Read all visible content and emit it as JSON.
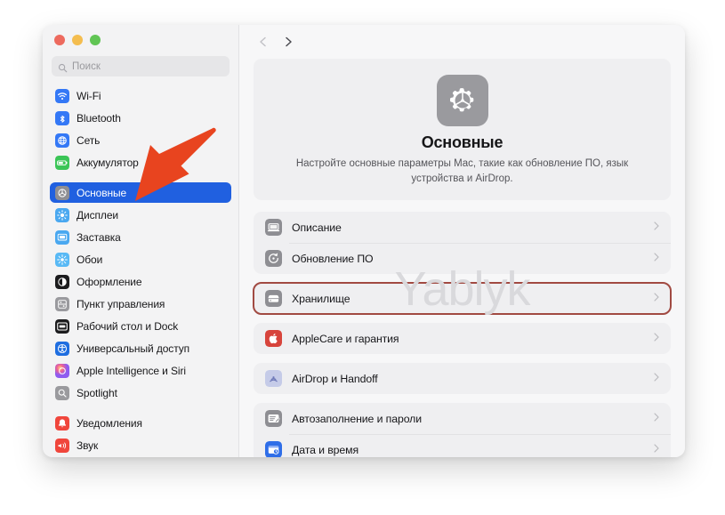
{
  "window": {
    "traffic_lights": [
      {
        "name": "close",
        "color": "#ed6a5e"
      },
      {
        "name": "minimize",
        "color": "#f4bd4f"
      },
      {
        "name": "maximize",
        "color": "#61c554"
      }
    ]
  },
  "search": {
    "placeholder": "Поиск",
    "value": "",
    "icon": "search-icon"
  },
  "sidebar": {
    "groups": [
      {
        "items": [
          {
            "label": "Wi-Fi",
            "icon": "wifi-icon",
            "color": "#3478f6",
            "selected": false
          },
          {
            "label": "Bluetooth",
            "icon": "bluetooth-icon",
            "color": "#3478f6",
            "selected": false
          },
          {
            "label": "Сеть",
            "icon": "globe-icon",
            "color": "#3478f6",
            "selected": false
          },
          {
            "label": "Аккумулятор",
            "icon": "battery-icon",
            "color": "#3bc557",
            "selected": false
          }
        ]
      },
      {
        "items": [
          {
            "label": "Основные",
            "icon": "gear-icon",
            "color": "#8e8e93",
            "selected": true
          },
          {
            "label": "Дисплеи",
            "icon": "display-icon",
            "color": "#4aa8f0",
            "selected": false
          },
          {
            "label": "Заставка",
            "icon": "screensaver-icon",
            "color": "#4aa8f0",
            "selected": false
          },
          {
            "label": "Обои",
            "icon": "wallpaper-icon",
            "color": "#59b9f5",
            "selected": false
          },
          {
            "label": "Оформление",
            "icon": "appearance-icon",
            "color": "#1c1c1e",
            "selected": false
          },
          {
            "label": "Пункт управления",
            "icon": "control-center-icon",
            "color": "#9a9a9e",
            "selected": false
          },
          {
            "label": "Рабочий стол и Dock",
            "icon": "desktop-dock-icon",
            "color": "#1c1c1e",
            "selected": false
          },
          {
            "label": "Универсальный доступ",
            "icon": "accessibility-icon",
            "color": "#1f6ee0",
            "selected": false
          },
          {
            "label": "Apple Intelligence и Siri",
            "icon": "siri-icon",
            "color": "#f06292",
            "selected": false
          },
          {
            "label": "Spotlight",
            "icon": "spotlight-icon",
            "color": "#9a9a9e",
            "selected": false
          }
        ]
      },
      {
        "items": [
          {
            "label": "Уведомления",
            "icon": "notifications-icon",
            "color": "#f0463c",
            "selected": false
          },
          {
            "label": "Звук",
            "icon": "sound-icon",
            "color": "#f0463c",
            "selected": false
          }
        ]
      }
    ]
  },
  "toolbar": {
    "back_label": "Назад",
    "forward_label": "Вперёд",
    "back_icon": "chevron-left-icon",
    "forward_icon": "chevron-right-icon"
  },
  "hero": {
    "icon": "gear-icon",
    "title": "Основные",
    "description": "Настройте основные параметры Mac, такие как обновление ПО, язык устройства и AirDrop."
  },
  "watermark": {
    "text": "Yablyk"
  },
  "annotations": {
    "arrow_color": "#e8441f",
    "highlight_color": "#a14a42",
    "arrow_target": "Основные",
    "highlight_target": "Хранилище"
  },
  "main": {
    "cards": [
      {
        "highlighted": false,
        "rows": [
          {
            "label": "Описание",
            "icon": "laptop-icon",
            "color": "#8e8e93",
            "chevron": "chevron-right-icon"
          },
          {
            "label": "Обновление ПО",
            "icon": "software-update-icon",
            "color": "#8e8e93",
            "chevron": "chevron-right-icon"
          }
        ]
      },
      {
        "highlighted": true,
        "rows": [
          {
            "label": "Хранилище",
            "icon": "storage-icon",
            "color": "#8e8e93",
            "chevron": "chevron-right-icon"
          }
        ]
      },
      {
        "highlighted": false,
        "rows": [
          {
            "label": "AppleCare и гарантия",
            "icon": "apple-logo-icon",
            "color": "#d7443c",
            "chevron": "chevron-right-icon"
          }
        ]
      },
      {
        "highlighted": false,
        "rows": [
          {
            "label": "AirDrop и Handoff",
            "icon": "airdrop-icon",
            "color": "#c5cbe8",
            "chevron": "chevron-right-icon"
          }
        ]
      },
      {
        "highlighted": false,
        "rows": [
          {
            "label": "Автозаполнение и пароли",
            "icon": "autofill-icon",
            "color": "#8e8e93",
            "chevron": "chevron-right-icon"
          },
          {
            "label": "Дата и время",
            "icon": "date-time-icon",
            "color": "#2f6ee8",
            "chevron": "chevron-right-icon"
          }
        ]
      }
    ]
  }
}
